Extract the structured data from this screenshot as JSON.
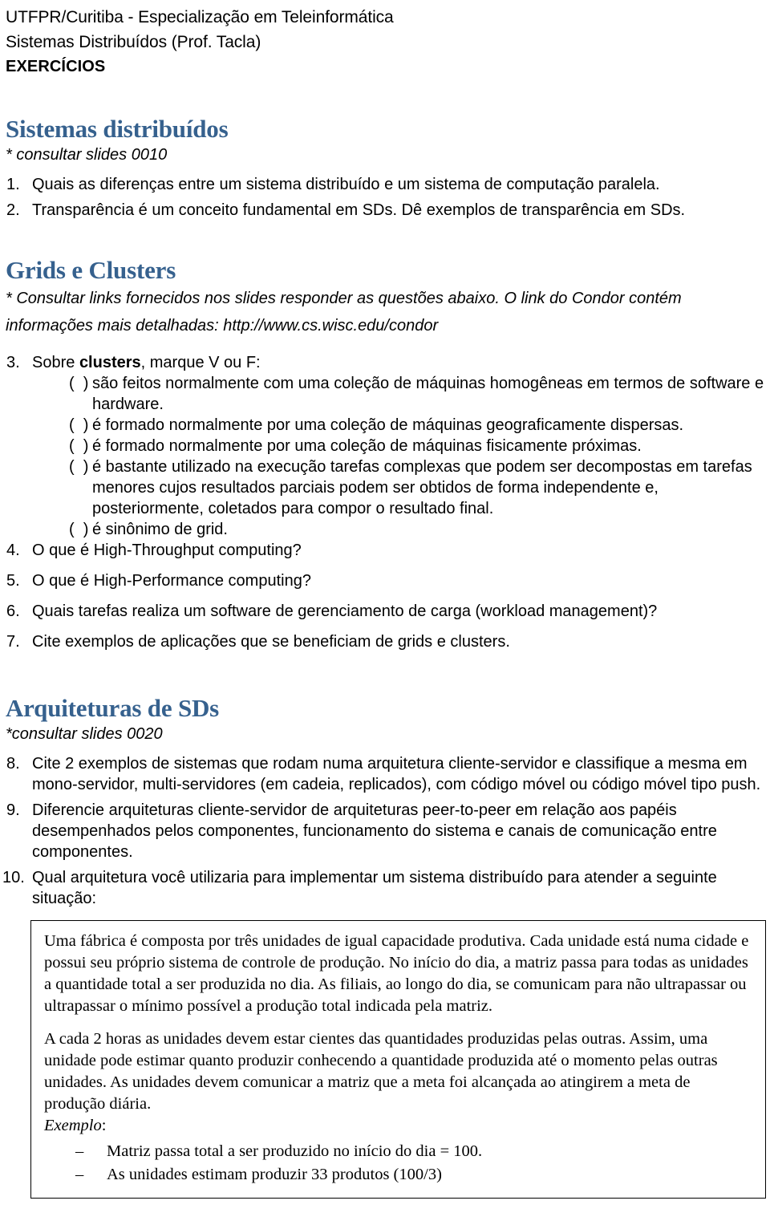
{
  "document": {
    "header": {
      "line1": "UTFPR/Curitiba - Especialização em Teleinformática",
      "line2": "Sistemas Distribuídos (Prof. Tacla)",
      "line3": "EXERCÍCIOS"
    },
    "heading_color": "#36618E",
    "sections": [
      {
        "heading": "Sistemas distribuídos",
        "note": "* consultar slides 0010",
        "questions": [
          {
            "num": "1.",
            "text": "Quais as diferenças entre um sistema distribuído e um sistema de computação paralela."
          },
          {
            "num": "2.",
            "text": "Transparência é um conceito fundamental em SDs. Dê exemplos de transparência em SDs."
          }
        ]
      },
      {
        "heading": "Grids e Clusters",
        "note_line1": "* Consultar links fornecidos nos slides responder as  questões abaixo. O link do Condor contém",
        "note_line2": "informações mais detalhadas: http://www.cs.wisc.edu/condor",
        "q3": {
          "num": "3.",
          "prefix": "Sobre ",
          "bold": "clusters",
          "suffix": ", marque V ou F:",
          "paren": "(  )",
          "options": [
            "são feitos normalmente com uma coleção de máquinas homogêneas em termos de software e hardware.",
            "é formado normalmente por uma coleção de máquinas geograficamente dispersas.",
            "é formado normalmente por uma coleção de máquinas fisicamente próximas.",
            "é bastante utilizado na execução tarefas complexas que podem ser decompostas em tarefas menores cujos resultados parciais podem ser obtidos de forma independente e, posteriormente, coletados para compor o resultado final.",
            "é sinônimo de grid."
          ]
        },
        "questions": [
          {
            "num": "4.",
            "text": "O que é High-Throughput computing?"
          },
          {
            "num": "5.",
            "text": "O que é High-Performance computing?"
          },
          {
            "num": "6.",
            "text": "Quais tarefas realiza um software de gerenciamento de carga (workload management)?"
          },
          {
            "num": "7.",
            "text": "Cite exemplos de aplicações que se beneficiam de grids e clusters."
          }
        ]
      },
      {
        "heading": "Arquiteturas de SDs",
        "note": "*consultar slides 0020",
        "questions": [
          {
            "num": "8.",
            "text": "Cite 2 exemplos de sistemas que rodam numa arquitetura cliente-servidor e classifique a mesma em mono-servidor, multi-servidores (em cadeia, replicados), com código móvel ou código móvel tipo push."
          },
          {
            "num": "9.",
            "text": "Diferencie arquiteturas cliente-servidor de arquiteturas peer-to-peer em relação aos papéis desempenhados pelos componentes, funcionamento do sistema e canais de comunicação entre componentes."
          },
          {
            "num": "10.",
            "text": "Qual arquitetura você utilizaria para implementar um sistema distribuído para atender a seguinte situação:"
          }
        ]
      }
    ],
    "scenario_box": {
      "paragraph1": "Uma fábrica é composta por três unidades de igual capacidade produtiva. Cada unidade está numa cidade e possui seu próprio sistema de controle de produção. No início do dia, a matriz passa para todas as unidades a quantidade total a ser produzida no dia. As filiais, ao longo do dia, se comunicam para não ultrapassar ou ultrapassar o mínimo possível a produção total indicada pela matriz.",
      "paragraph2": "A cada 2 horas as unidades devem estar cientes das quantidades produzidas pelas outras. Assim, uma unidade pode estimar quanto produzir conhecendo a quantidade produzida até o momento pelas outras unidades. As unidades devem comunicar a matriz que a meta foi alcançada ao atingirem a meta de produção diária.",
      "example_label": "Exemplo",
      "example_colon": ":",
      "dash": "–",
      "examples": [
        "Matriz passa total a ser produzido no início do dia = 100.",
        "As unidades estimam produzir 33 produtos (100/3)"
      ]
    }
  }
}
